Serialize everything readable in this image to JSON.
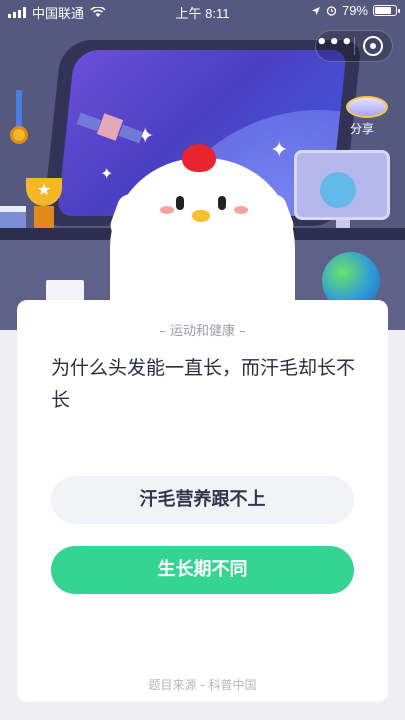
{
  "status_bar": {
    "carrier": "中国联通",
    "time": "上午 8:11",
    "battery_percent": "79%",
    "battery_level": 0.79
  },
  "capsule": {
    "more_icon": "ellipsis-icon",
    "close_icon": "close-circle-icon"
  },
  "header": {
    "share_label": "分享"
  },
  "card": {
    "category": "运动和健康",
    "question": "为什么头发能一直长，而汗毛却长不长",
    "options": [
      {
        "label": "汗毛营养跟不上"
      },
      {
        "label": "生长期不同"
      }
    ],
    "source": "题目来源 - 科普中国"
  },
  "colors": {
    "accent_green": "#35d491",
    "scene_bg": "#4b4d75"
  }
}
